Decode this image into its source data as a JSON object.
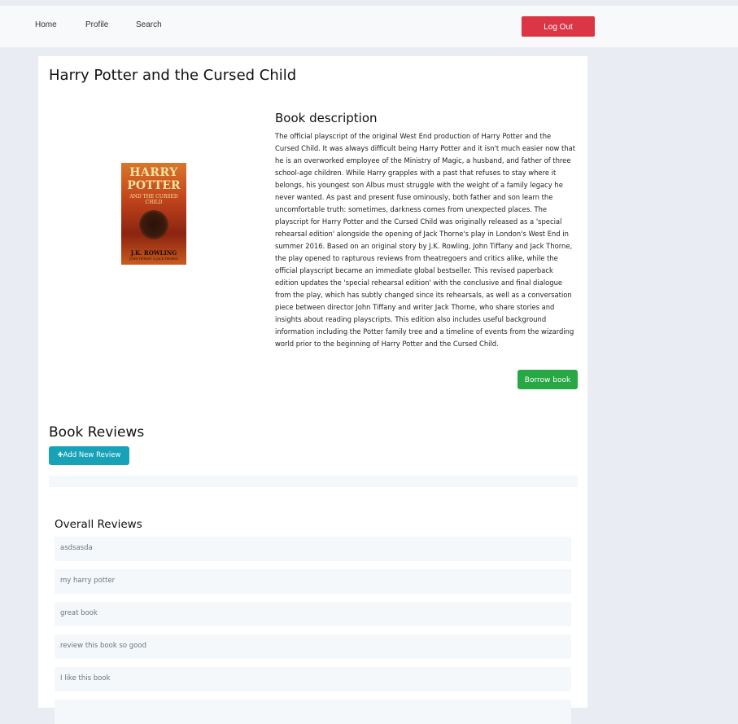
{
  "nav": {
    "home": "Home",
    "profile": "Profile",
    "search": "Search",
    "logout": "Log Out"
  },
  "book": {
    "title": "Harry Potter and the Cursed Child",
    "cover": {
      "line1": "HARRY",
      "line2": "POTTER",
      "subtitle": "AND THE CURSED CHILD",
      "author": "J.K. ROWLING",
      "author2": "JOHN TIFFANY & JACK THORNE"
    },
    "description_heading": "Book description",
    "description": "The official playscript of the original West End production of Harry Potter and the Cursed Child. It was always difficult being Harry Potter and it isn't much easier now that he is an overworked employee of the Ministry of Magic, a husband, and father of three school-age children. While Harry grapples with a past that refuses to stay where it belongs, his youngest son Albus must struggle with the weight of a family legacy he never wanted. As past and present fuse ominously, both father and son learn the uncomfortable truth: sometimes, darkness comes from unexpected places. The playscript for Harry Potter and the Cursed Child was originally released as a 'special rehearsal edition' alongside the opening of Jack Thorne's play in London's West End in summer 2016. Based on an original story by J.K. Rowling, John Tiffany and Jack Thorne, the play opened to rapturous reviews from theatregoers and critics alike, while the official playscript became an immediate global bestseller. This revised paperback edition updates the 'special rehearsal edition' with the conclusive and final dialogue from the play, which has subtly changed since its rehearsals, as well as a conversation piece between director John Tiffany and writer Jack Thorne, who share stories and insights about reading playscripts. This edition also includes useful background information including the Potter family tree and a timeline of events from the wizarding world prior to the beginning of Harry Potter and the Cursed Child.",
    "borrow_label": "Borrow book"
  },
  "reviews": {
    "heading": "Book Reviews",
    "add_label": "✚Add New Review",
    "overall_heading": "Overall Reviews",
    "items": [
      "asdsasda",
      "my harry potter",
      "great book",
      "review this book so good",
      "I like this book",
      ""
    ]
  },
  "colors": {
    "logout": "#dc3545",
    "borrow": "#28a745",
    "add_review": "#17a2b8",
    "page_bg": "#e9ecf2"
  }
}
